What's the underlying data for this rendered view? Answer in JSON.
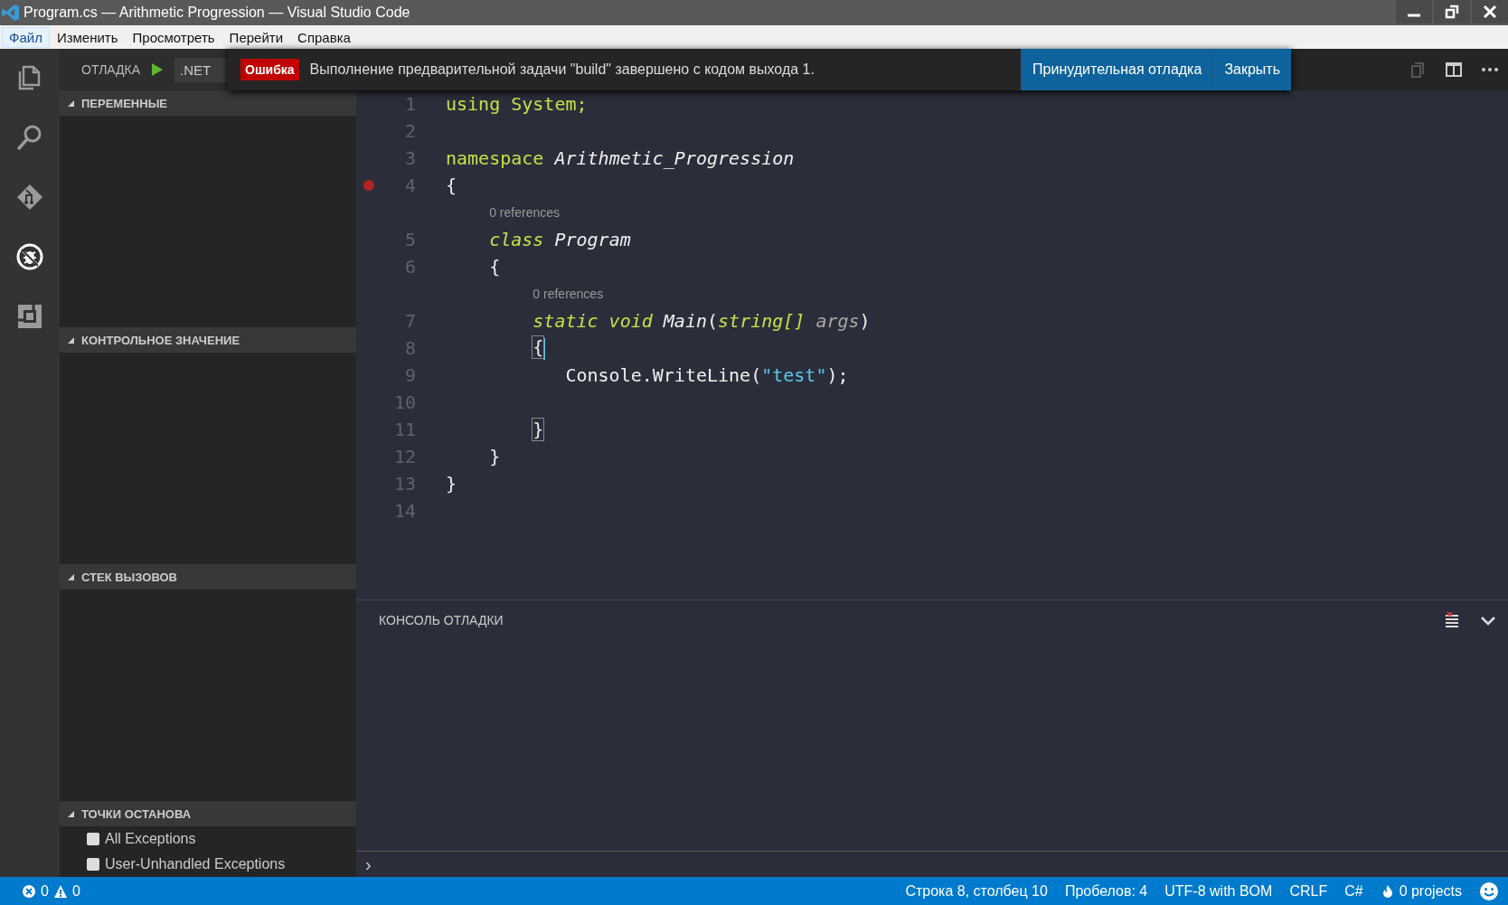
{
  "window": {
    "title": "Program.cs — Arithmetic Progression — Visual Studio Code"
  },
  "menu": [
    {
      "label": "Файл",
      "selected": true
    },
    {
      "label": "Изменить",
      "selected": false
    },
    {
      "label": "Просмотреть",
      "selected": false
    },
    {
      "label": "Перейти",
      "selected": false
    },
    {
      "label": "Справка",
      "selected": false
    }
  ],
  "activity_bar": [
    {
      "kind": "files",
      "selected": false
    },
    {
      "kind": "search",
      "selected": false
    },
    {
      "kind": "git",
      "selected": false
    },
    {
      "kind": "debug",
      "selected": true
    },
    {
      "kind": "extensions",
      "selected": false
    }
  ],
  "debug_toolbar": {
    "title": "ОТЛАДКА",
    "configuration": ".NET"
  },
  "notification": {
    "severity": "Ошибка",
    "message": "Выполнение предварительной задачи \"build\" завершено с кодом выхода 1.",
    "actions": [
      "Принудительная отладка",
      "Закрыть"
    ]
  },
  "sidebar_sections": [
    {
      "title": "ПЕРЕМЕННЫЕ",
      "expanded": true
    },
    {
      "title": "КОНТРОЛЬНОЕ ЗНАЧЕНИЕ",
      "expanded": true
    },
    {
      "title": "СТЕК ВЫЗОВОВ",
      "expanded": true
    },
    {
      "title": "ТОЧКИ ОСТАНОВА",
      "expanded": true,
      "items": [
        {
          "label": "All Exceptions",
          "checked": false
        },
        {
          "label": "User-Unhandled Exceptions",
          "checked": false
        }
      ]
    }
  ],
  "editor": {
    "lines": [
      {
        "kind": "code",
        "number": "1",
        "breakpoint": false,
        "cursor": false,
        "tokens": [
          {
            "kind": "keyword",
            "text": "using System;"
          }
        ]
      },
      {
        "kind": "code",
        "number": "2",
        "breakpoint": false,
        "cursor": false
      },
      {
        "kind": "code",
        "number": "3",
        "breakpoint": false,
        "cursor": false,
        "tokens": [
          {
            "kind": "keyword",
            "text": "namespace "
          },
          {
            "kind": "entity",
            "text": "Arithmetic_Progression"
          }
        ]
      },
      {
        "kind": "code",
        "number": "4",
        "breakpoint": true,
        "cursor": false,
        "tokens": [
          {
            "kind": "plain",
            "text": "{"
          }
        ]
      },
      {
        "kind": "codelens",
        "text": "    0 references"
      },
      {
        "kind": "code",
        "number": "5",
        "breakpoint": false,
        "cursor": false,
        "tokens": [
          {
            "kind": "storage",
            "text": "    class "
          },
          {
            "kind": "entity",
            "text": "Program"
          }
        ]
      },
      {
        "kind": "code",
        "number": "6",
        "breakpoint": false,
        "cursor": false,
        "tokens": [
          {
            "kind": "plain",
            "text": "    {"
          }
        ]
      },
      {
        "kind": "codelens",
        "text": "        0 references"
      },
      {
        "kind": "code",
        "number": "7",
        "breakpoint": false,
        "cursor": false,
        "tokens": [
          {
            "kind": "storage",
            "text": "        static void "
          },
          {
            "kind": "entity",
            "text": "Main"
          },
          {
            "kind": "plain",
            "text": "("
          },
          {
            "kind": "storage",
            "text": "string[] "
          },
          {
            "kind": "param",
            "text": "args"
          },
          {
            "kind": "plain",
            "text": ")"
          }
        ]
      },
      {
        "kind": "code",
        "number": "8",
        "breakpoint": false,
        "cursor": true,
        "tokens": [
          {
            "kind": "bracket",
            "text": "        {"
          }
        ]
      },
      {
        "kind": "code",
        "number": "9",
        "breakpoint": false,
        "cursor": false,
        "tokens": [
          {
            "kind": "plain",
            "text": "           Console.WriteLine("
          },
          {
            "kind": "string",
            "text": "\"test\""
          },
          {
            "kind": "plain",
            "text": ");"
          }
        ]
      },
      {
        "kind": "code",
        "number": "10",
        "breakpoint": false,
        "cursor": false
      },
      {
        "kind": "code",
        "number": "11",
        "breakpoint": false,
        "cursor": false,
        "tokens": [
          {
            "kind": "bracket",
            "text": "        }"
          }
        ]
      },
      {
        "kind": "code",
        "number": "12",
        "breakpoint": false,
        "cursor": false,
        "tokens": [
          {
            "kind": "plain",
            "text": "    }"
          }
        ]
      },
      {
        "kind": "code",
        "number": "13",
        "breakpoint": false,
        "cursor": false,
        "tokens": [
          {
            "kind": "plain",
            "text": "}"
          }
        ]
      },
      {
        "kind": "code",
        "number": "14",
        "breakpoint": false,
        "cursor": false
      }
    ]
  },
  "panel": {
    "title": "КОНСОЛЬ ОТЛАДКИ",
    "prompt": "›"
  },
  "status_bar": {
    "errors": "0",
    "warnings": "0",
    "items": [
      {
        "kind": "text",
        "text": "Строка 8, столбец 10"
      },
      {
        "kind": "text",
        "text": "Пробелов: 4"
      },
      {
        "kind": "text",
        "text": "UTF-8 with BOM"
      },
      {
        "kind": "text",
        "text": "CRLF"
      },
      {
        "kind": "text",
        "text": "C#"
      },
      {
        "kind": "projects",
        "text": "0 projects"
      },
      {
        "kind": "feedback"
      }
    ]
  }
}
